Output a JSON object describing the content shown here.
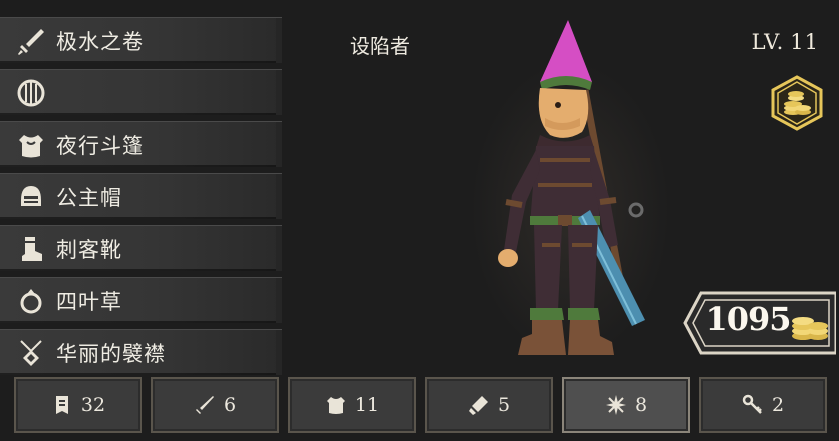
{
  "equipment": {
    "weapon": "极水之卷",
    "shield": "",
    "armor": "夜行斗篷",
    "helmet": "公主帽",
    "boots": "刺客靴",
    "ring": "四叶草",
    "amulet": "华丽的襞襟"
  },
  "character": {
    "name": "设陷者",
    "level_prefix": "LV.",
    "level": "11"
  },
  "currency": {
    "amount": "1095"
  },
  "tabs": [
    {
      "icon": "armor-piece-icon",
      "count": "32"
    },
    {
      "icon": "sword-icon",
      "count": "6"
    },
    {
      "icon": "chest-armor-icon",
      "count": "11"
    },
    {
      "icon": "boot-scroll-icon",
      "count": "5"
    },
    {
      "icon": "shuriken-icon",
      "count": "8",
      "active": true
    },
    {
      "icon": "key-icon",
      "count": "2"
    }
  ],
  "colors": {
    "gold": "#e6c65a",
    "hat_pink": "#d54ec4",
    "panel": "#3a3a3a"
  }
}
